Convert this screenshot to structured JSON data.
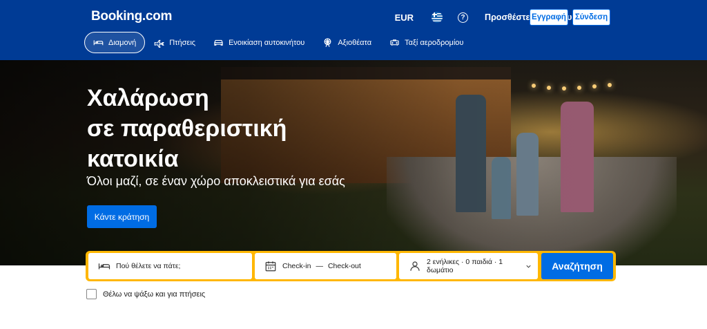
{
  "header": {
    "logo": "Booking.com",
    "currency": "EUR",
    "language_icon": "greece-flag-icon",
    "help_icon": "question-circle-icon",
    "list_property": "Προσθέστε το κατάλυμά σας",
    "register": "Εγγραφή",
    "sign_in": "Σύνδεση",
    "background_color": "#003b95"
  },
  "nav": {
    "items": [
      {
        "label": "Διαμονή",
        "icon": "bed-icon",
        "active": true
      },
      {
        "label": "Πτήσεις",
        "icon": "plane-icon",
        "active": false
      },
      {
        "label": "Ενοικίαση αυτοκινήτου",
        "icon": "car-icon",
        "active": false
      },
      {
        "label": "Αξιοθέατα",
        "icon": "ferris-wheel-icon",
        "active": false
      },
      {
        "label": "Ταξί αεροδρομίου",
        "icon": "taxi-icon",
        "active": false
      }
    ]
  },
  "hero": {
    "title_line1": "Χαλάρωση",
    "title_line2": "σε παραθεριστική",
    "title_line3": "κατοικία",
    "subtitle": "Όλοι μαζί, σε έναν χώρο αποκλειστικά για εσάς",
    "cta": "Κάντε κράτηση"
  },
  "search": {
    "destination_placeholder": "Πού θέλετε να πάτε;",
    "checkin": "Check-in",
    "dash": "—",
    "checkout": "Check-out",
    "guests": "2 ενήλικες · 0 παιδιά · 1 δωμάτιο",
    "button": "Αναζήτηση",
    "accent_color": "#ffb700",
    "button_color": "#006ce4"
  },
  "options": {
    "flights_checkbox": "Θέλω να ψάξω και για πτήσεις",
    "flights_checked": false
  }
}
